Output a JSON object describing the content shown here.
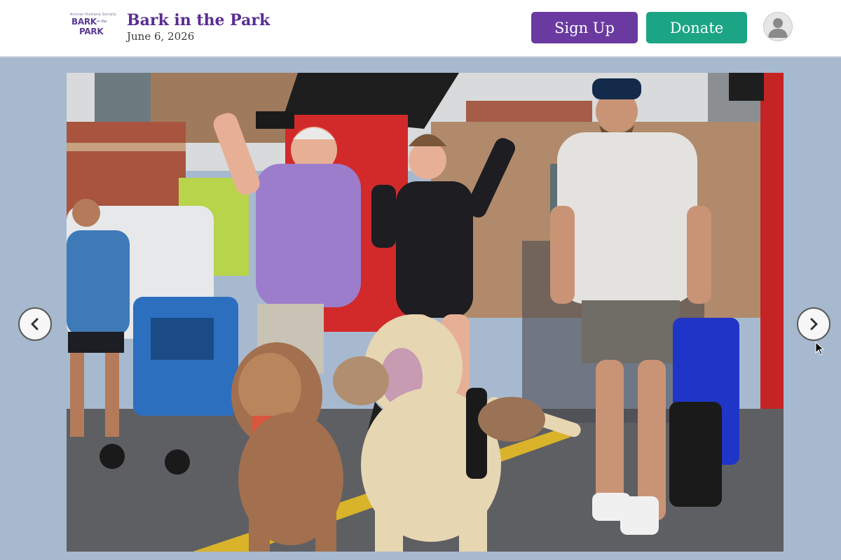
{
  "header": {
    "logo": {
      "org_text": "Animal Humane Society",
      "line1": "BARK",
      "line2": "in the",
      "line3": "PARK"
    },
    "title": "Bark in the Park",
    "date": "June 6, 2026",
    "signup_label": "Sign Up",
    "donate_label": "Donate",
    "avatar_icon": "user-avatar-icon"
  },
  "carousel": {
    "photo_alt": "Participants walking dogs at the Bark in the Park event",
    "prev_icon": "chevron-left-icon",
    "next_icon": "chevron-right-icon"
  },
  "colors": {
    "brand_purple": "#5a2d91",
    "signup_bg": "#6a3aa0",
    "donate_bg": "#1ba585",
    "page_bg": "#a7b9cf"
  }
}
